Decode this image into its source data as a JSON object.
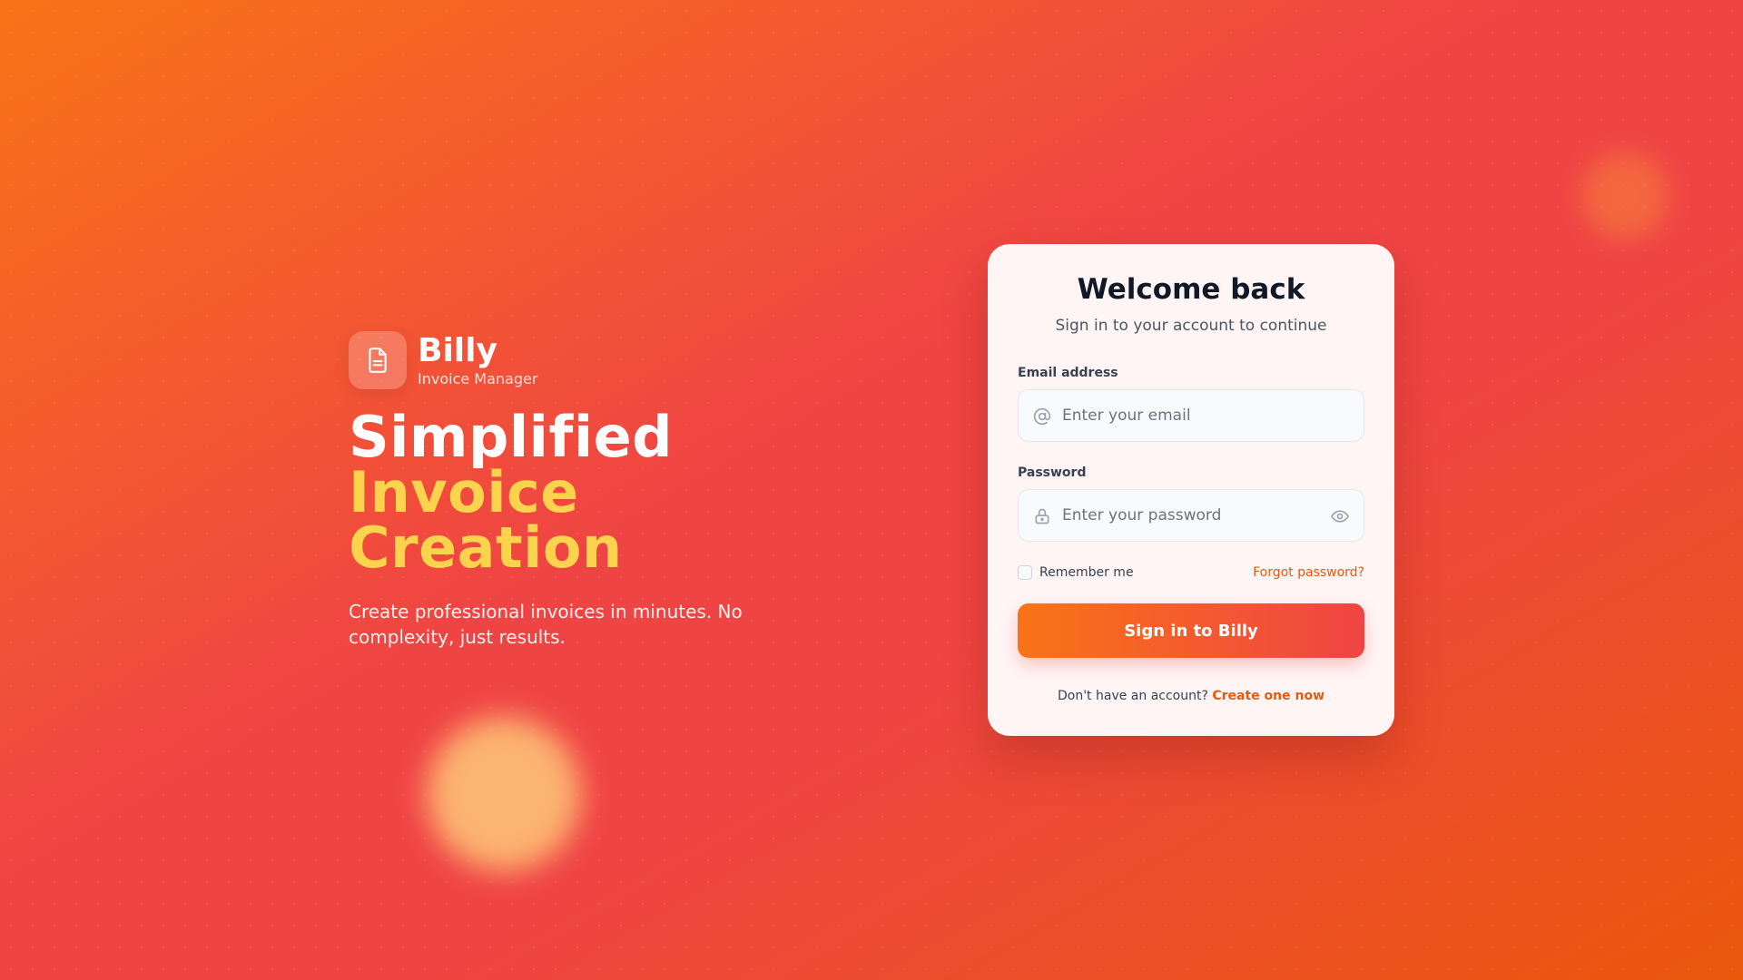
{
  "brand": {
    "name": "Billy",
    "subtitle": "Invoice Manager",
    "icon": "document-icon"
  },
  "hero": {
    "headline_line1": "Simplified",
    "headline_line2": "Invoice",
    "headline_line3": "Creation",
    "tagline": "Create professional invoices in minutes. No complexity, just results."
  },
  "login": {
    "title": "Welcome back",
    "subtitle": "Sign in to your account to continue",
    "email_label": "Email address",
    "email_placeholder": "Enter your email",
    "email_value": "",
    "email_icon": "at-sign-icon",
    "password_label": "Password",
    "password_placeholder": "Enter your password",
    "password_value": "",
    "password_icon": "lock-icon",
    "toggle_icon": "eye-icon",
    "remember_label": "Remember me",
    "remember_checked": false,
    "forgot_label": "Forgot password?",
    "submit_label": "Sign in to Billy",
    "signup_prompt": "Don't have an account?",
    "signup_link": "Create one now"
  },
  "colors": {
    "gradient_start": "#f97316",
    "gradient_mid": "#ef4444",
    "gradient_end": "#ea580c",
    "headline_accent": "#fcd34d",
    "link": "#ea580c",
    "card_bg": "#fff5f5"
  }
}
